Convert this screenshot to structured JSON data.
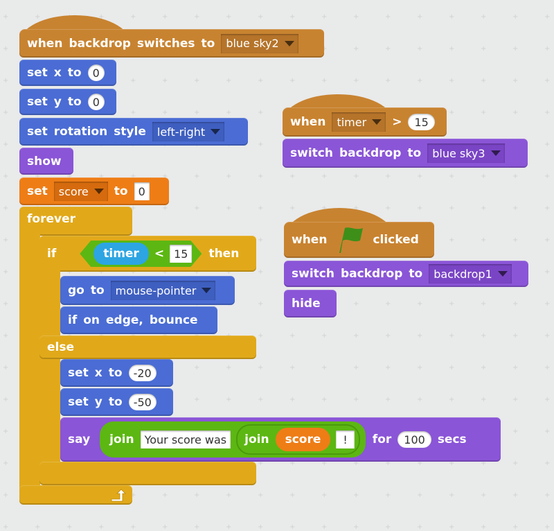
{
  "workspace": "scripts-area",
  "scripts": {
    "backdrop_script": {
      "hat": {
        "when": "when",
        "backdrop": "backdrop",
        "switches": "switches",
        "to": "to",
        "backdrop_value": "blue sky2"
      },
      "set_x": {
        "set": "set",
        "x": "x",
        "to": "to",
        "value": "0"
      },
      "set_y": {
        "set": "set",
        "y": "y",
        "to": "to",
        "value": "0"
      },
      "rotation": {
        "set": "set",
        "rotation": "rotation",
        "style": "style",
        "value": "left-right"
      },
      "show": {
        "label": "show"
      },
      "set_var": {
        "set": "set",
        "variable": "score",
        "to": "to",
        "value": "0"
      },
      "forever": {
        "label": "forever"
      },
      "if_block": {
        "if": "if",
        "then": "then",
        "reporter": "timer",
        "operator": "<",
        "value": "15",
        "goto": {
          "go": "go",
          "to": "to",
          "value": "mouse-pointer"
        },
        "bounce": {
          "w1": "if",
          "w2": "on",
          "w3": "edge,",
          "w4": "bounce"
        },
        "else": "else",
        "set_x": {
          "set": "set",
          "x": "x",
          "to": "to",
          "value": "-20"
        },
        "set_y": {
          "set": "set",
          "y": "y",
          "to": "to",
          "value": "-50"
        },
        "say": {
          "say": "say",
          "join1": "join",
          "text1": "Your score was",
          "join2": "join",
          "reporter": "score",
          "text2": "!",
          "for": "for",
          "secs_value": "100",
          "secs": "secs"
        }
      }
    },
    "timer_script": {
      "hat": {
        "when": "when",
        "sensor": "timer",
        "operator": ">",
        "value": "15"
      },
      "switch": {
        "switch": "switch",
        "backdrop": "backdrop",
        "to": "to",
        "value": "blue sky3"
      }
    },
    "flag_script": {
      "hat": {
        "when": "when",
        "clicked": "clicked",
        "icon": "green-flag-icon",
        "flag_color": "#3d8f1a"
      },
      "switch": {
        "switch": "switch",
        "backdrop": "backdrop",
        "to": "to",
        "value": "backdrop1"
      },
      "hide": {
        "label": "hide"
      }
    }
  },
  "colors": {
    "motion": "#4a6cd4",
    "looks": "#8a55d7",
    "data": "#ee7d16",
    "events": "#c88330",
    "control": "#e1a91a",
    "operators": "#5cb712",
    "sensing": "#2ca5e2",
    "background": "#dfe0e0"
  }
}
